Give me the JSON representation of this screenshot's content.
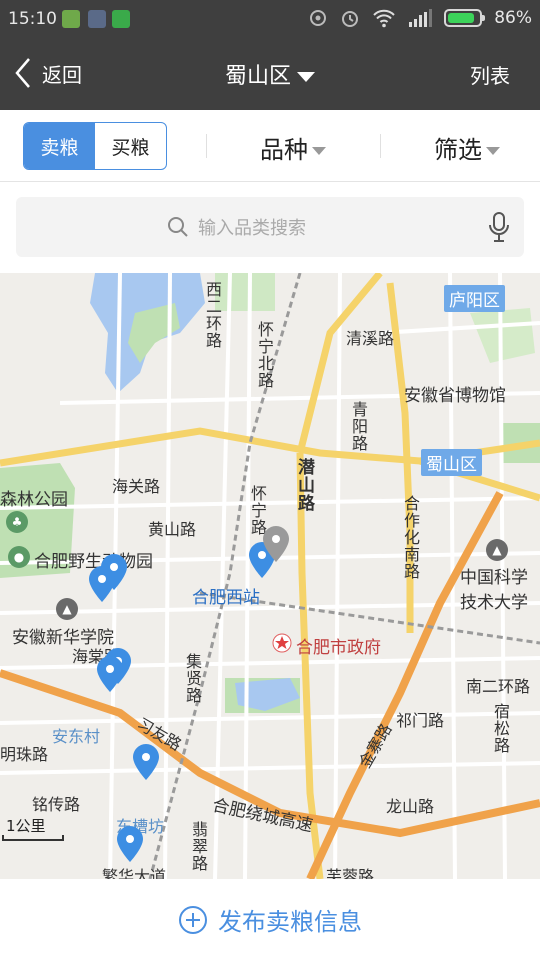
{
  "status": {
    "time": "15:10",
    "battery_pct": "86%",
    "battery_level": 0.86
  },
  "nav": {
    "back_label": "返回",
    "title": "蜀山区",
    "list_label": "列表"
  },
  "filter": {
    "sell_label": "卖粮",
    "buy_label": "买粮",
    "variety_label": "品种",
    "filter_label": "筛选",
    "active_tab": "sell"
  },
  "search": {
    "placeholder": "输入品类搜索"
  },
  "map": {
    "labels": {
      "luyang": "庐阳区",
      "shushan": "蜀山区",
      "xi_er_huan": "西二环路",
      "huaining_bei": "怀宁北路",
      "qingxi": "清溪路",
      "museum": "安徽省博物馆",
      "qingyang": "青阳路",
      "qianshan": "潜山路",
      "hefu_nan": "合作化南路",
      "haiguan": "海关路",
      "huangshan": "黄山路",
      "huaining": "怀宁路",
      "forest_park": "森林公园",
      "zoo": "合肥野生动物园",
      "west_station": "合肥西站",
      "ustc": "中国科学技术大学",
      "xinhua": "安徽新华学院",
      "haitang": "海棠路",
      "government": "合肥市政府",
      "nan_er_huan": "南二环路",
      "jixian": "集贤路",
      "qimen": "祁门路",
      "susong": "宿松路",
      "andong": "安东村",
      "mingzhu": "明珠路",
      "wenyou": "习友路",
      "jinzhai": "金寨路",
      "mingchuan": "铭传路",
      "ring_expressway": "合肥绕城高速",
      "longshan": "龙山路",
      "dongcaofang": "东槽坊",
      "fenghe": "翡翠路",
      "fanhua": "繁华大道",
      "furong": "芙蓉路"
    },
    "scale_label": "1公里"
  },
  "bottom": {
    "publish_label": "发布卖粮信息"
  },
  "colors": {
    "accent": "#4a8fe0",
    "bar": "#3f3f3f",
    "pin": "#3d8ee3",
    "pin_gray": "#9a9a9a"
  }
}
